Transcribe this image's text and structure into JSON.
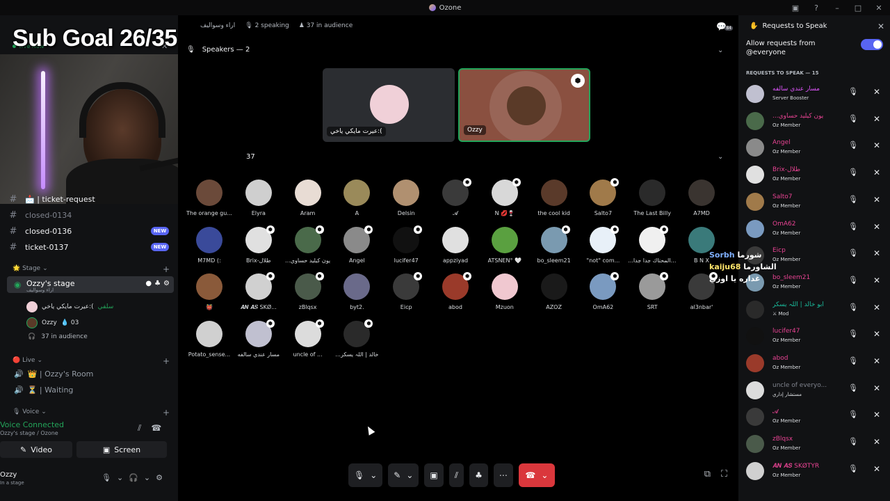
{
  "window": {
    "title": "Ozone"
  },
  "overlay": {
    "sub_goal": "Sub Goal 26/35",
    "chat": [
      {
        "user": "Sorbh",
        "message": "شورما"
      },
      {
        "user": "kaiju68",
        "message": "الشاورما غداره يا اوزي"
      }
    ]
  },
  "sidebar": {
    "live_now": "Live Now",
    "channels": [
      {
        "label": "📩 | ticket-request",
        "dim": false
      },
      {
        "label": "closed-0134",
        "dim": true
      },
      {
        "label": "closed-0136",
        "dim": false,
        "badge": "NEW"
      },
      {
        "label": "ticket-0137",
        "dim": false,
        "badge": "NEW"
      }
    ],
    "stage_category": "🌟 Stage",
    "stage_channel": {
      "name": "Ozzy's stage",
      "topic": "اراء وسواليف"
    },
    "stage_members": [
      {
        "name": "عيرت مايكي ياخي:(",
        "tag": "سلفي"
      },
      {
        "name": "Ozzy",
        "tag": "💧 03"
      }
    ],
    "stage_audience": "37 in audience",
    "live_category": "🔴 Live",
    "live_channels": [
      "👑 | Ozzy's Room",
      "⏳ | Waiting"
    ],
    "voice_category": "🎙 Voice",
    "voice_connected": "Voice Connected",
    "voice_location": "Ozzy's stage / Ozone",
    "video_label": "Video",
    "screen_label": "Screen",
    "user": {
      "name": "Ozzy",
      "status": "In a stage"
    }
  },
  "stage": {
    "topic": "اراء وسواليف",
    "speaking": "2 speaking",
    "in_audience": "37 in audience",
    "notifications": "84",
    "speakers_heading": "Speakers — 2",
    "speakers": [
      {
        "name": "عيرت مايكي ياخي:(",
        "color": "#f0d0d8"
      },
      {
        "name": "Ozzy",
        "color": "#5a3a28"
      }
    ],
    "audience_heading_count": "37",
    "audience": [
      {
        "name": "The orange gu...",
        "color": "#6b4a3a",
        "badge": false
      },
      {
        "name": "Elyra",
        "color": "#cfcfcf",
        "badge": false
      },
      {
        "name": "Aram",
        "color": "#e8dcd4",
        "badge": false
      },
      {
        "name": "A",
        "color": "#9a8a5a",
        "badge": false
      },
      {
        "name": "Delsin",
        "color": "#b09070",
        "badge": false
      },
      {
        "name": "𝓐",
        "color": "#3a3a3a",
        "badge": true
      },
      {
        "name": "N 💋🍷",
        "color": "#d8d8d8",
        "badge": true
      },
      {
        "name": "the cool kid",
        "color": "#5a3a2a",
        "badge": false
      },
      {
        "name": "Salto7",
        "color": "#a07a4a",
        "badge": true
      },
      {
        "name": "The Last Billy",
        "color": "#2a2a2a",
        "badge": false
      },
      {
        "name": "A7MD",
        "color": "#3a3430",
        "badge": false
      },
      {
        "name": "M7MD (:",
        "color": "#3a4a9a",
        "badge": false
      },
      {
        "name": "Brix-طلال",
        "color": "#e0e0e0",
        "badge": true
      },
      {
        "name": "...يون كيليد حساوي",
        "color": "#4a6a4a",
        "badge": true
      },
      {
        "name": "Angel",
        "color": "#8a8a8a",
        "badge": true
      },
      {
        "name": "lucifer47",
        "color": "#111111",
        "badge": true
      },
      {
        "name": "appziyad",
        "color": "#e0e0e0",
        "badge": false
      },
      {
        "name": "ATSNEN° 🤍",
        "color": "#5aa040",
        "badge": false
      },
      {
        "name": "bo_sleem21",
        "color": "#7a9ab0",
        "badge": true
      },
      {
        "name": "\"not\" com...",
        "color": "#e8f0f8",
        "badge": true
      },
      {
        "name": "...يون المحتاك جدا جدا",
        "color": "#f0f0f0",
        "badge": true
      },
      {
        "name": "B N X",
        "color": "#3a7a7a",
        "badge": false
      },
      {
        "name": "👹",
        "color": "#8a5a3a",
        "badge": false
      },
      {
        "name": "𝑨𝑵 𝑨𝑺 SKØ...",
        "color": "#d0d0d0",
        "badge": true
      },
      {
        "name": "zBlqsx",
        "color": "#4a5a4a",
        "badge": true
      },
      {
        "name": "byt2.",
        "color": "#6a6a8a",
        "badge": false
      },
      {
        "name": "Eicp",
        "color": "#3a3a3a",
        "badge": true
      },
      {
        "name": "abod",
        "color": "#9a3a2a",
        "badge": true
      },
      {
        "name": "Mzuon",
        "color": "#f0c8d0",
        "badge": false
      },
      {
        "name": "AZOZ",
        "color": "#1a1a1a",
        "badge": false
      },
      {
        "name": "OmA62",
        "color": "#7a9ac0",
        "badge": true
      },
      {
        "name": "SRT",
        "color": "#9a9a9a",
        "badge": true
      },
      {
        "name": "al3nbar'",
        "color": "#3a3a3a",
        "badge": true
      },
      {
        "name": "Potato_sense...",
        "color": "#d0d0d0",
        "badge": false
      },
      {
        "name": "مسار عندي سالفه",
        "color": "#c0c0d0",
        "badge": true
      },
      {
        "name": "uncle of ...",
        "color": "#dcdcdc",
        "badge": true
      },
      {
        "name": "...خالد | اللہ يسكر",
        "color": "#2a2a2a",
        "badge": true
      }
    ]
  },
  "requests": {
    "title": "Requests to Speak",
    "allow_label": "Allow requests from @everyone",
    "section_label": "REQUESTS TO SPEAK — 15",
    "items": [
      {
        "name": "مسار عندي سالفه",
        "role": "Server Booster",
        "color": "#e056fd",
        "avatar": "#c0c0d0"
      },
      {
        "name": "...يون كيليد حساوي",
        "role": "Oz Member",
        "color": "#e84393",
        "avatar": "#4a6a4a"
      },
      {
        "name": "Angel",
        "role": "Oz Member",
        "color": "#e84393",
        "avatar": "#8a8a8a"
      },
      {
        "name": "Brix-طلال",
        "role": "Oz Member",
        "color": "#e84393",
        "avatar": "#e0e0e0"
      },
      {
        "name": "Salto7",
        "role": "Oz Member",
        "color": "#e84393",
        "avatar": "#a07a4a"
      },
      {
        "name": "OmA62",
        "role": "Oz Member",
        "color": "#e84393",
        "avatar": "#7a9ac0"
      },
      {
        "name": "Eicp",
        "role": "Oz Member",
        "color": "#e84393",
        "avatar": "#3a3a3a"
      },
      {
        "name": "bo_sleem21",
        "role": "Oz Member",
        "color": "#e84393",
        "avatar": "#7a9ab0"
      },
      {
        "name": "ابو خالد | اللہ يسكر",
        "role": "⚔ Mod",
        "color": "#1abc9c",
        "avatar": "#2a2a2a"
      },
      {
        "name": "lucifer47",
        "role": "Oz Member",
        "color": "#e84393",
        "avatar": "#111111"
      },
      {
        "name": "abod",
        "role": "Oz Member",
        "color": "#e84393",
        "avatar": "#9a3a2a"
      },
      {
        "name": "uncle of everyo...",
        "role": "مستشار إداري",
        "color": "#80848e",
        "avatar": "#dcdcdc"
      },
      {
        "name": "𝓐",
        "role": "Oz Member",
        "color": "#e84393",
        "avatar": "#3a3a3a"
      },
      {
        "name": "zBlqsx",
        "role": "Oz Member",
        "color": "#e84393",
        "avatar": "#4a5a4a"
      },
      {
        "name": "𝑨𝑵 𝑨𝑺 SKØTYR",
        "role": "Oz Member",
        "color": "#e84393",
        "avatar": "#d0d0d0"
      }
    ]
  },
  "colors": {
    "accent": "#5865f2",
    "online": "#23a55a",
    "danger": "#da373c"
  }
}
